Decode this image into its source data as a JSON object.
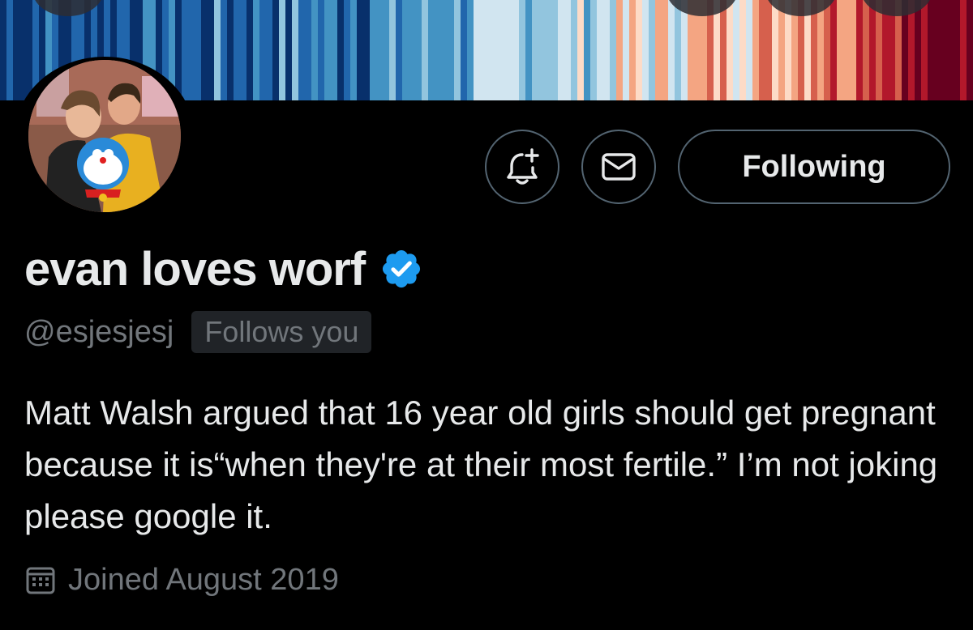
{
  "banner": {
    "colors": [
      "#08306b",
      "#2166ac",
      "#4393c3",
      "#92c5de",
      "#d1e5f0",
      "#fddbc7",
      "#f4a582",
      "#d6604d",
      "#b2182b",
      "#67001f"
    ]
  },
  "profile": {
    "name": "evan loves worf",
    "handle": "@esjesjesj",
    "follows_you_label": "Follows you",
    "verified": true,
    "bio": "Matt Walsh argued that 16 year old girls should get pregnant because it is“when they're at their most fertile.” I’m not joking please google it.",
    "joined": "Joined August 2019"
  },
  "actions": {
    "notify_icon": "bell-plus-icon",
    "message_icon": "envelope-icon",
    "following_label": "Following"
  },
  "colors": {
    "background": "#000000",
    "text_primary": "#e7e9ea",
    "text_secondary": "#71767b",
    "verified_blue": "#1d9bf0",
    "border": "#536471"
  }
}
